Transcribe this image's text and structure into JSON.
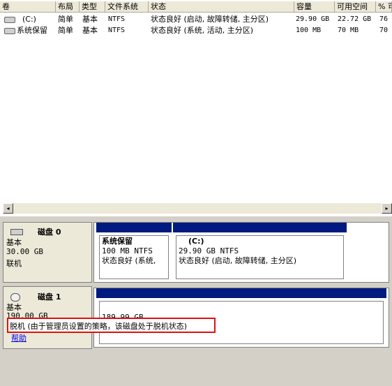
{
  "columns": [
    "卷",
    "布局",
    "类型",
    "文件系统",
    "状态",
    "容量",
    "可用空间",
    "% 可"
  ],
  "volumes": [
    {
      "name": "(C:)",
      "layout": "简单",
      "type": "基本",
      "fs": "NTFS",
      "status": "状态良好 (启动, 故障转储, 主分区)",
      "capacity": "29.90 GB",
      "free": "22.72 GB",
      "pct": "76"
    },
    {
      "name": "系统保留",
      "layout": "简单",
      "type": "基本",
      "fs": "NTFS",
      "status": "状态良好 (系统, 活动, 主分区)",
      "capacity": "100 MB",
      "free": "70 MB",
      "pct": "70"
    }
  ],
  "disks": [
    {
      "title": "磁盘 0",
      "kind": "基本",
      "size": "30.00 GB",
      "state": "联机",
      "partitions": [
        {
          "title": "系统保留",
          "size_fs": "100 MB NTFS",
          "status": "状态良好 (系统,"
        },
        {
          "title": "(C:)",
          "size_fs": "29.90 GB NTFS",
          "status": "状态良好 (启动, 故障转储, 主分区)"
        }
      ]
    },
    {
      "title": "磁盘 1",
      "kind": "基本",
      "size": "190.00 GB",
      "state": "脱机 (由于管理员设置的策略，该磁盘处于脱机状态)",
      "help": "帮助",
      "partitions": [
        {
          "size": "189.99 GB"
        }
      ]
    }
  ],
  "scroll": {
    "left": "◂",
    "right": "▸"
  }
}
